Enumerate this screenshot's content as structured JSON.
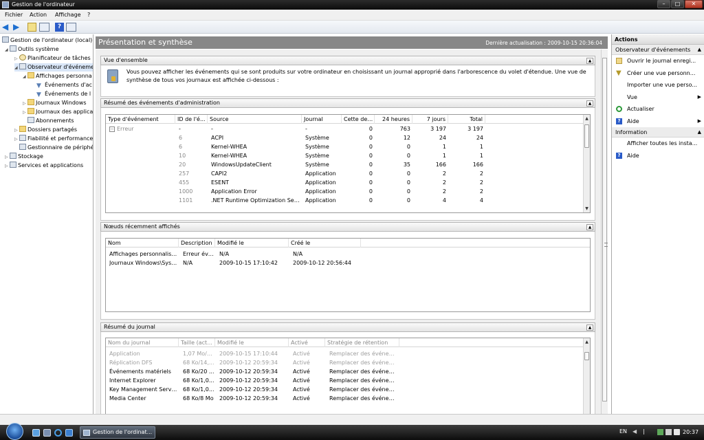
{
  "window": {
    "title": "Gestion de l'ordinateur",
    "controls": {
      "minimize": "–",
      "maximize": "□",
      "close": "✕"
    }
  },
  "menu": [
    "Fichier",
    "Action",
    "Affichage",
    "?"
  ],
  "tree": [
    {
      "label": "Gestion de l'ordinateur (local)",
      "icon": "computer-icon",
      "level": 0
    },
    {
      "label": "Outils système",
      "icon": "tools-icon",
      "level": 1,
      "expanded": true
    },
    {
      "label": "Planificateur de tâches",
      "icon": "clock-icon",
      "level": 2
    },
    {
      "label": "Observateur d'événeme",
      "icon": "event-viewer-icon",
      "level": 2,
      "expanded": true,
      "selected": true
    },
    {
      "label": "Affichages personna",
      "icon": "folder-icon",
      "level": 3,
      "expanded": true
    },
    {
      "label": "Événements d'ac",
      "icon": "filter-icon",
      "level": 4
    },
    {
      "label": "Événements de l",
      "icon": "filter-icon",
      "level": 4
    },
    {
      "label": "Journaux Windows",
      "icon": "folder-icon",
      "level": 3
    },
    {
      "label": "Journaux des applica",
      "icon": "folder-icon",
      "level": 3
    },
    {
      "label": "Abonnements",
      "icon": "subscription-icon",
      "level": 3
    },
    {
      "label": "Dossiers partagés",
      "icon": "shared-folder-icon",
      "level": 2
    },
    {
      "label": "Fiabilité et performance",
      "icon": "performance-icon",
      "level": 2
    },
    {
      "label": "Gestionnaire de périphé",
      "icon": "device-manager-icon",
      "level": 2
    },
    {
      "label": "Stockage",
      "icon": "storage-icon",
      "level": 1
    },
    {
      "label": "Services et applications",
      "icon": "services-icon",
      "level": 1
    }
  ],
  "header": {
    "title": "Présentation et synthèse",
    "last_refresh": "Dernière actualisation : 2009-10-15 20:36:04"
  },
  "overview": {
    "title": "Vue d'ensemble",
    "text": "Vous pouvez afficher les événements qui se sont produits sur votre ordinateur en choisissant un journal approprié dans l'arborescence du volet d'étendue. Une vue de synthèse de tous vos journaux est affichée ci-dessous :"
  },
  "admin_summary": {
    "title": "Résumé des événements d'administration",
    "columns": [
      "Type d'événement",
      "ID de l'é...",
      "Source",
      "Journal",
      "Cette der...",
      "24 heures",
      "7 jours",
      "Total"
    ],
    "rows": [
      [
        "Erreur",
        "-",
        "-",
        "-",
        "0",
        "763",
        "3 197",
        "3 197"
      ],
      [
        "",
        "6",
        "ACPI",
        "Système",
        "0",
        "12",
        "24",
        "24"
      ],
      [
        "",
        "6",
        "Kernel-WHEA",
        "Système",
        "0",
        "0",
        "1",
        "1"
      ],
      [
        "",
        "10",
        "Kernel-WHEA",
        "Système",
        "0",
        "0",
        "1",
        "1"
      ],
      [
        "",
        "20",
        "WindowsUpdateClient",
        "Système",
        "0",
        "35",
        "166",
        "166"
      ],
      [
        "",
        "257",
        "CAPI2",
        "Application",
        "0",
        "0",
        "2",
        "2"
      ],
      [
        "",
        "455",
        "ESENT",
        "Application",
        "0",
        "0",
        "2",
        "2"
      ],
      [
        "",
        "1000",
        "Application Error",
        "Application",
        "0",
        "0",
        "2",
        "2"
      ],
      [
        "",
        "1101",
        ".NET Runtime Optimization Serv...",
        "Application",
        "0",
        "0",
        "4",
        "4"
      ]
    ]
  },
  "recent_nodes": {
    "title": "Nœuds récemment affichés",
    "columns": [
      "Nom",
      "Description",
      "Modifié le",
      "Créé le"
    ],
    "rows": [
      [
        "Affichages personnalisés...",
        "Erreur évé...",
        "N/A",
        "N/A"
      ],
      [
        "Journaux Windows\\Systè...",
        "N/A",
        "2009-10-15 17:10:42",
        "2009-10-12 20:56:44"
      ]
    ]
  },
  "log_summary": {
    "title": "Résumé du journal",
    "columns": [
      "Nom du journal",
      "Taille (act...",
      "Modifié le",
      "Activé",
      "Stratégie de rétention"
    ],
    "rows": [
      [
        "Application",
        "1,07 Mo/2...",
        "2009-10-15 17:10:44",
        "Activé",
        "Remplacer des événeme..."
      ],
      [
        "Réplication DFS",
        "68 Ko/14,...",
        "2009-10-12 20:59:34",
        "Activé",
        "Remplacer des événeme..."
      ],
      [
        "Événements matériels",
        "68 Ko/20 ...",
        "2009-10-12 20:59:34",
        "Activé",
        "Remplacer des événeme..."
      ],
      [
        "Internet Explorer",
        "68 Ko/1,0...",
        "2009-10-12 20:59:34",
        "Activé",
        "Remplacer des événeme..."
      ],
      [
        "Key Management Service",
        "68 Ko/1,0...",
        "2009-10-12 20:59:34",
        "Activé",
        "Remplacer des événeme..."
      ],
      [
        "Media Center",
        "68 Ko/8 Mo",
        "2009-10-12 20:59:34",
        "Activé",
        "Remplacer des événeme..."
      ]
    ]
  },
  "actions": {
    "title": "Actions",
    "group1": {
      "title": "Observateur d'événements",
      "items": [
        {
          "label": "Ouvrir le journal enregi...",
          "icon": "open-log-icon",
          "submenu": false
        },
        {
          "label": "Créer une vue personn...",
          "icon": "filter-icon",
          "submenu": false
        },
        {
          "label": "Importer une vue perso...",
          "icon": "",
          "submenu": false
        },
        {
          "label": "Vue",
          "icon": "",
          "submenu": true
        },
        {
          "label": "Actualiser",
          "icon": "refresh-icon",
          "submenu": false
        },
        {
          "label": "Aide",
          "icon": "help-icon",
          "submenu": true
        }
      ]
    },
    "group2": {
      "title": "Information",
      "items": [
        {
          "label": "Afficher toutes les insta...",
          "icon": "",
          "submenu": false
        },
        {
          "label": "Aide",
          "icon": "help-icon",
          "submenu": false
        }
      ]
    }
  },
  "taskbar": {
    "window_button": "Gestion de l'ordinat...",
    "language": "EN",
    "clock": "20:37"
  }
}
